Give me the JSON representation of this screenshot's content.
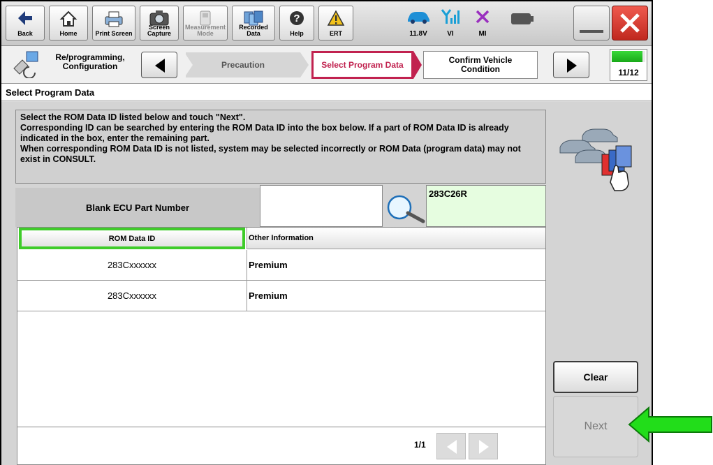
{
  "toolbar": {
    "back": "Back",
    "home": "Home",
    "print_screen": "Print Screen",
    "screen_capture": "Screen\nCapture",
    "measurement_mode": "Measurement\nMode",
    "recorded_data": "Recorded\nData",
    "help": "Help",
    "ert": "ERT",
    "battery_voltage": "11.8V",
    "vi": "VI",
    "mi": "MI"
  },
  "stepbar": {
    "mode_label": "Re/programming,\nConfiguration",
    "steps": [
      "Precaution",
      "Select Program Data",
      "Confirm Vehicle\nCondition"
    ],
    "progress_text": "11/12",
    "progress_fraction": 0.92
  },
  "page_title": "Select Program Data",
  "instruction": "Select the ROM Data ID listed below and touch \"Next\".\nCorresponding ID can be searched by entering the ROM Data ID into the box below. If a part of ROM Data ID is already indicated in the box, enter the remaining part.\nWhen corresponding ROM Data ID is not listed, system may be selected incorrectly or ROM Data (program data) may not exist in CONSULT.",
  "ecu": {
    "label": "Blank ECU Part Number",
    "part_number_value": "",
    "rom_search_value": "283C26R"
  },
  "table": {
    "headers": [
      "ROM Data ID",
      "Other Information"
    ],
    "rows": [
      {
        "rom_id": "283Cxxxxxx",
        "info": "Premium"
      },
      {
        "rom_id": "283Cxxxxxx",
        "info": "Premium"
      }
    ]
  },
  "pager": {
    "page": "1/1"
  },
  "buttons": {
    "clear": "Clear",
    "next": "Next"
  },
  "colors": {
    "current_step": "#c1224f",
    "highlight": "#3fcc2a",
    "search_field_bg": "#e6fde0",
    "close_red": "#d8382c"
  },
  "icons": [
    "back-arrow-icon",
    "home-icon",
    "printer-icon",
    "camera-icon",
    "measurement-icon",
    "recorded-data-icon",
    "help-icon",
    "warning-icon",
    "car-icon",
    "signal-icon",
    "mi-x-icon",
    "battery-icon",
    "close-icon",
    "search-icon",
    "pointer-arrow-icon"
  ]
}
